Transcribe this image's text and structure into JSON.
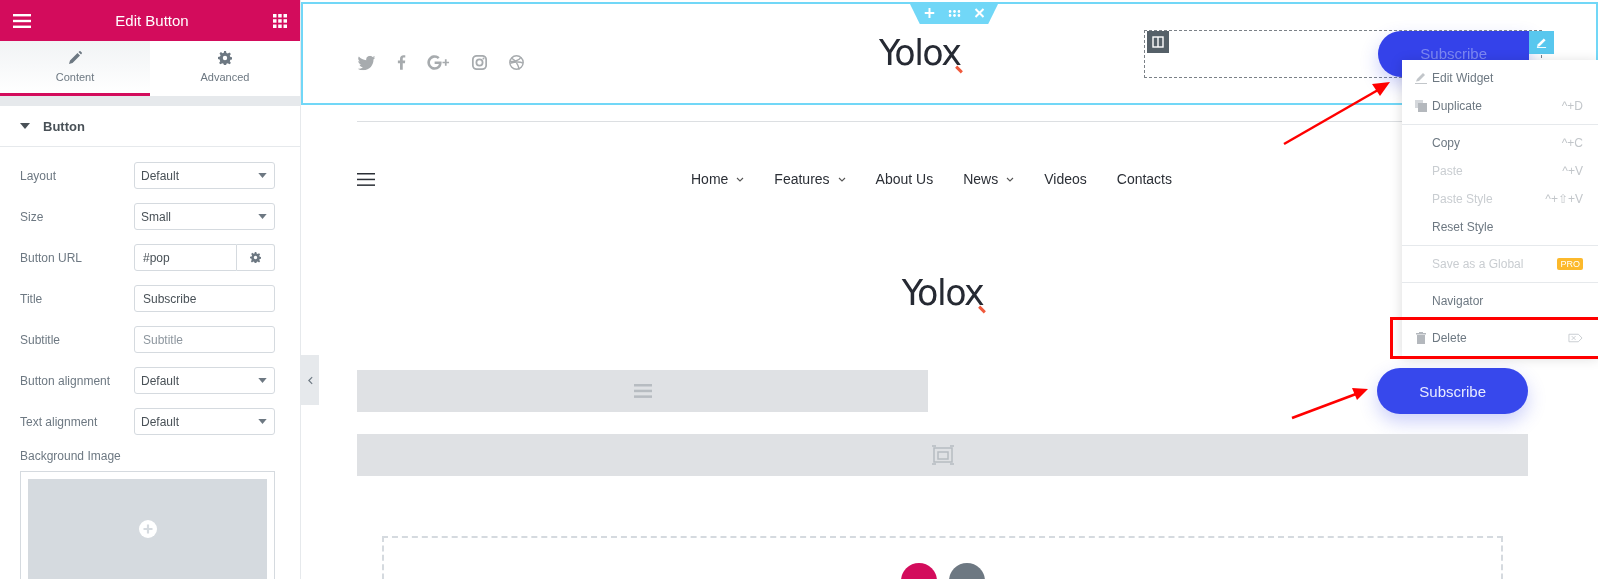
{
  "editor": {
    "title": "Edit Button",
    "tabs": [
      {
        "label": "Content",
        "kind": "pencil",
        "selected": true
      },
      {
        "label": "Advanced",
        "kind": "gear",
        "selected": false
      }
    ],
    "section": {
      "title": "Button",
      "expanded": true
    },
    "controls": [
      {
        "kind": "select",
        "label": "Layout",
        "value": "Default"
      },
      {
        "kind": "select",
        "label": "Size",
        "value": "Small"
      },
      {
        "kind": "url",
        "label": "Button URL",
        "value": "#pop"
      },
      {
        "kind": "text",
        "label": "Title",
        "value": "Subscribe"
      },
      {
        "kind": "text",
        "label": "Subtitle",
        "placeholder": "Subtitle"
      },
      {
        "kind": "select",
        "label": "Button alignment",
        "value": "Default"
      },
      {
        "kind": "select",
        "label": "Text alignment",
        "value": "Default"
      }
    ],
    "background_image": {
      "label": "Background Image"
    }
  },
  "preview": {
    "header": {
      "logo": "Yolox",
      "button": "Subscribe"
    },
    "nav": [
      {
        "label": "Home",
        "dropdown": true
      },
      {
        "label": "Features",
        "dropdown": true
      },
      {
        "label": "About Us",
        "dropdown": false
      },
      {
        "label": "News",
        "dropdown": true
      },
      {
        "label": "Videos",
        "dropdown": false
      },
      {
        "label": "Contacts",
        "dropdown": false
      }
    ],
    "logo": "Yolox",
    "button": "Subscribe"
  },
  "context_menu": {
    "groups": [
      [
        {
          "label": "Edit Widget",
          "kind": "edit",
          "disabled": false
        },
        {
          "label": "Duplicate",
          "kind": "duplicate",
          "shortcut": "^+D",
          "disabled": false
        }
      ],
      [
        {
          "label": "Copy",
          "kind": "plain",
          "shortcut": "^+C",
          "disabled": false
        },
        {
          "label": "Paste",
          "kind": "plain",
          "shortcut": "^+V",
          "disabled": true
        },
        {
          "label": "Paste Style",
          "kind": "plain",
          "shortcut": "^+⇧+V",
          "disabled": true
        },
        {
          "label": "Reset Style",
          "kind": "plain",
          "disabled": false
        }
      ],
      [
        {
          "label": "Save as a Global",
          "kind": "plain",
          "badge": "PRO",
          "disabled": true
        }
      ],
      [
        {
          "label": "Navigator",
          "kind": "plain",
          "disabled": false
        }
      ],
      [
        {
          "label": "Delete",
          "kind": "delete",
          "disabled": false,
          "highlighted": true
        }
      ]
    ]
  }
}
